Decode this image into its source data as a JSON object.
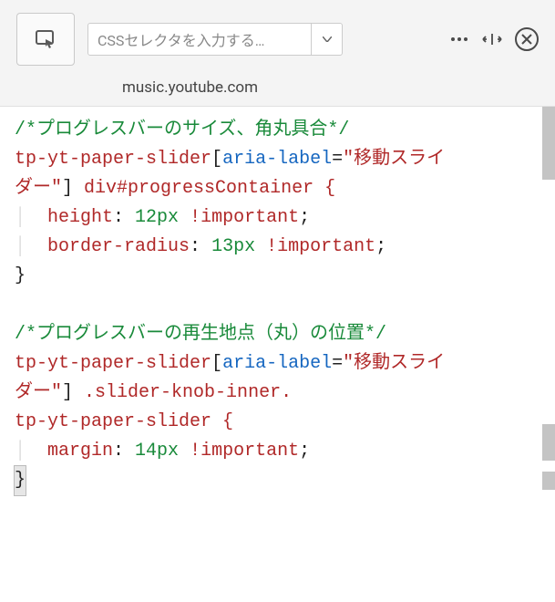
{
  "toolbar": {
    "selector_placeholder": "CSSセレクタを入力する…",
    "domain": "music.youtube.com"
  },
  "code": {
    "block1": {
      "comment": "/*プログレスバーのサイズ、角丸具合*/",
      "sel_tag": "tp-yt-paper-slider",
      "sel_attr_name": "aria-label",
      "sel_attr_val_line1": "\"移動スライ",
      "sel_attr_val_line2": "ダー\"",
      "sel_rest": " div#progressContainer {",
      "prop1": "height",
      "val1": "12px",
      "imp": "!important",
      "prop2": "border-radius",
      "val2": "13px",
      "close": "}"
    },
    "block2": {
      "comment": "/*プログレスバーの再生地点（丸）の位置*/",
      "sel_tag": "tp-yt-paper-slider",
      "sel_attr_name": "aria-label",
      "sel_attr_val_line1": "\"移動スライ",
      "sel_attr_val_line2": "ダー\"",
      "sel_rest1": " .slider-knob-inner.",
      "sel_rest2": "tp-yt-paper-slider {",
      "prop1": "margin",
      "val1": "14px",
      "imp": "!important",
      "close": "}"
    }
  }
}
